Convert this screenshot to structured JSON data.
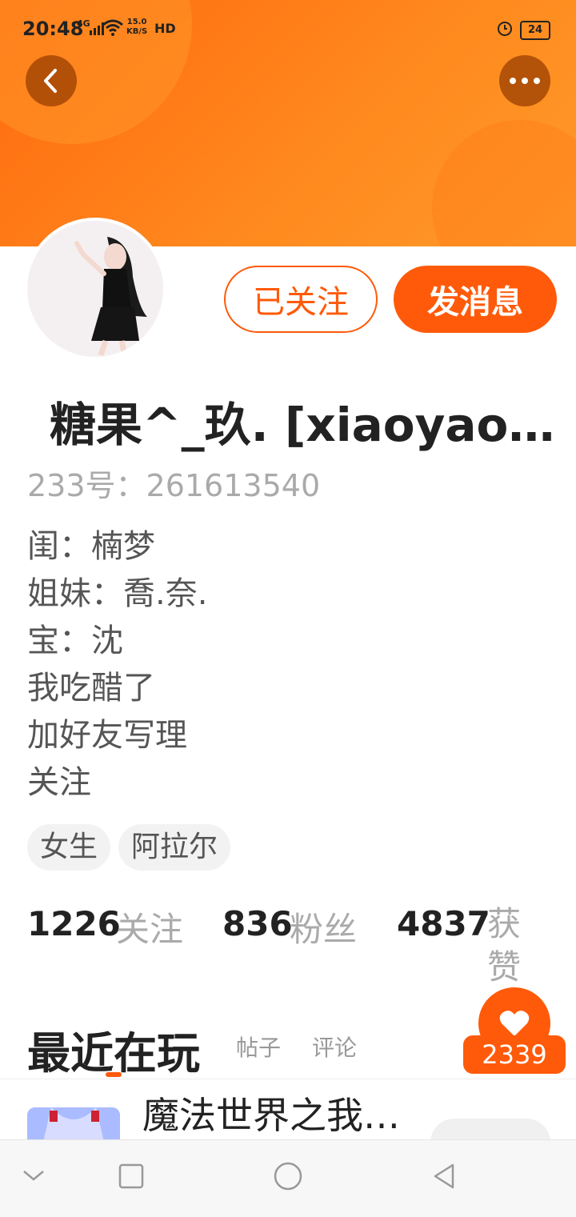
{
  "status_bar": {
    "time": "20:48",
    "signal_label": "4G",
    "speed_value": "15.0",
    "speed_unit": "KB/S",
    "hd_label": "HD",
    "battery": "24"
  },
  "colors": {
    "accent": "#ff5a0a",
    "header": "#ff7a14"
  },
  "header": {
    "back_icon": "chevron-left-icon",
    "more_icon": "more-dots-icon"
  },
  "actions": {
    "follow_label": "已关注",
    "message_label": "发消息"
  },
  "profile": {
    "name": "糖果^_玖. [xiaoyao…",
    "uid": "233号：261613540",
    "bio_lines": [
      "闺：楠梦",
      "姐妹：喬.奈.",
      "宝：沈",
      "我吃醋了",
      "加好友写理",
      "关注"
    ],
    "tags": [
      "女生",
      "阿拉尔"
    ]
  },
  "stats": [
    {
      "num": "1226",
      "label": "关注"
    },
    {
      "num": "836",
      "label": "粉丝"
    },
    {
      "num": "4837",
      "label": "获赞"
    }
  ],
  "tabs": {
    "active": "最近在玩",
    "posts": "帖子",
    "comments": "评论"
  },
  "like_count": "2339",
  "recent_game": {
    "title": "魔法世界之我…"
  }
}
